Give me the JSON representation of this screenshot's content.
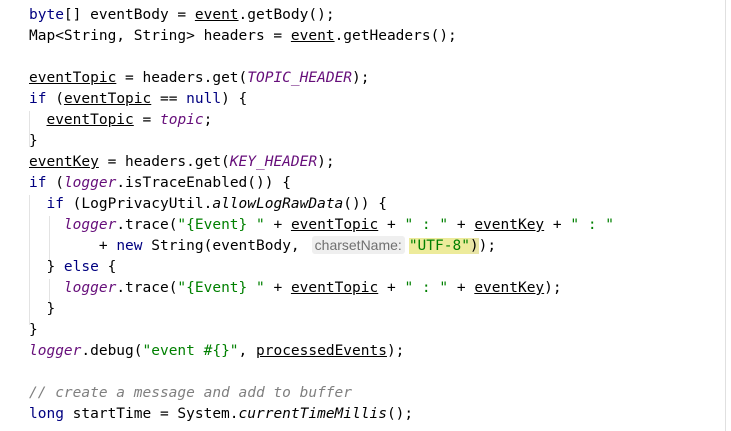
{
  "editor": {
    "colors": {
      "keyword": "#000080",
      "field": "#660e7a",
      "string": "#008000",
      "comment": "#808080",
      "hint_bg": "#efefef",
      "highlight": "#edeb9b"
    },
    "lines": [
      {
        "s": [
          {
            "t": "byte",
            "c": "kw"
          },
          {
            "t": "[] eventBody = ",
            "c": "pl"
          },
          {
            "t": "event",
            "c": "pl u"
          },
          {
            "t": ".getBody();",
            "c": "pl"
          }
        ]
      },
      {
        "s": [
          {
            "t": "Map<String, String> headers = ",
            "c": "pl"
          },
          {
            "t": "event",
            "c": "pl u"
          },
          {
            "t": ".getHeaders();",
            "c": "pl"
          }
        ]
      },
      {
        "s": []
      },
      {
        "s": [
          {
            "t": "eventTopic",
            "c": "pl u"
          },
          {
            "t": " = headers.get(",
            "c": "pl"
          },
          {
            "t": "TOPIC_HEADER",
            "c": "fld"
          },
          {
            "t": ");",
            "c": "pl"
          }
        ]
      },
      {
        "s": [
          {
            "t": "if",
            "c": "kw"
          },
          {
            "t": " (",
            "c": "pl"
          },
          {
            "t": "eventTopic",
            "c": "pl u"
          },
          {
            "t": " == ",
            "c": "pl"
          },
          {
            "t": "null",
            "c": "kw"
          },
          {
            "t": ") {",
            "c": "pl"
          }
        ]
      },
      {
        "s": [
          {
            "t": "  ",
            "c": "pl"
          },
          {
            "t": "eventTopic",
            "c": "pl u"
          },
          {
            "t": " = ",
            "c": "pl"
          },
          {
            "t": "topic",
            "c": "fld"
          },
          {
            "t": ";",
            "c": "pl"
          }
        ]
      },
      {
        "s": [
          {
            "t": "}",
            "c": "pl"
          }
        ]
      },
      {
        "s": [
          {
            "t": "eventKey",
            "c": "pl u"
          },
          {
            "t": " = headers.get(",
            "c": "pl"
          },
          {
            "t": "KEY_HEADER",
            "c": "fld"
          },
          {
            "t": ");",
            "c": "pl"
          }
        ]
      },
      {
        "s": [
          {
            "t": "if",
            "c": "kw"
          },
          {
            "t": " (",
            "c": "pl"
          },
          {
            "t": "logger",
            "c": "fld"
          },
          {
            "t": ".isTraceEnabled()) {",
            "c": "pl"
          }
        ]
      },
      {
        "s": [
          {
            "t": "  ",
            "c": "pl"
          },
          {
            "t": "if",
            "c": "kw"
          },
          {
            "t": " (LogPrivacyUtil.",
            "c": "pl"
          },
          {
            "t": "allowLogRawData",
            "c": "mth"
          },
          {
            "t": "()) {",
            "c": "pl"
          }
        ]
      },
      {
        "s": [
          {
            "t": "    ",
            "c": "pl"
          },
          {
            "t": "logger",
            "c": "fld"
          },
          {
            "t": ".trace(",
            "c": "pl"
          },
          {
            "t": "\"{Event} \"",
            "c": "str"
          },
          {
            "t": " + ",
            "c": "pl"
          },
          {
            "t": "eventTopic",
            "c": "pl u"
          },
          {
            "t": " + ",
            "c": "pl"
          },
          {
            "t": "\" : \"",
            "c": "str"
          },
          {
            "t": " + ",
            "c": "pl"
          },
          {
            "t": "eventKey",
            "c": "pl u"
          },
          {
            "t": " + ",
            "c": "pl"
          },
          {
            "t": "\" : \"",
            "c": "str"
          }
        ]
      },
      {
        "s": [
          {
            "t": "        + ",
            "c": "pl"
          },
          {
            "t": "new",
            "c": "kw"
          },
          {
            "t": " String(eventBody,",
            "c": "pl"
          },
          {
            "t": "charsetName:",
            "c": "hint"
          },
          {
            "t": "\"UTF-8\"",
            "c": "str strhl"
          },
          {
            "t": ")",
            "c": "pl brhl"
          },
          {
            "t": ");",
            "c": "pl"
          }
        ]
      },
      {
        "s": [
          {
            "t": "  } ",
            "c": "pl"
          },
          {
            "t": "else",
            "c": "kw"
          },
          {
            "t": " {",
            "c": "pl"
          }
        ]
      },
      {
        "s": [
          {
            "t": "    ",
            "c": "pl"
          },
          {
            "t": "logger",
            "c": "fld"
          },
          {
            "t": ".trace(",
            "c": "pl"
          },
          {
            "t": "\"{Event} \"",
            "c": "str"
          },
          {
            "t": " + ",
            "c": "pl"
          },
          {
            "t": "eventTopic",
            "c": "pl u"
          },
          {
            "t": " + ",
            "c": "pl"
          },
          {
            "t": "\" : \"",
            "c": "str"
          },
          {
            "t": " + ",
            "c": "pl"
          },
          {
            "t": "eventKey",
            "c": "pl u"
          },
          {
            "t": ");",
            "c": "pl"
          }
        ]
      },
      {
        "s": [
          {
            "t": "  }",
            "c": "pl"
          }
        ]
      },
      {
        "s": [
          {
            "t": "}",
            "c": "pl"
          }
        ]
      },
      {
        "s": [
          {
            "t": "logger",
            "c": "fld"
          },
          {
            "t": ".debug(",
            "c": "pl"
          },
          {
            "t": "\"event #{}\"",
            "c": "str"
          },
          {
            "t": ", ",
            "c": "pl"
          },
          {
            "t": "processedEvents",
            "c": "pl u"
          },
          {
            "t": ");",
            "c": "pl"
          }
        ]
      },
      {
        "s": []
      },
      {
        "s": [
          {
            "t": "// create a message and add to buffer",
            "c": "cmt"
          }
        ]
      },
      {
        "s": [
          {
            "t": "long",
            "c": "kw"
          },
          {
            "t": " startTime = System.",
            "c": "pl"
          },
          {
            "t": "currentTimeMillis",
            "c": "mth"
          },
          {
            "t": "();",
            "c": "pl"
          }
        ]
      }
    ]
  }
}
